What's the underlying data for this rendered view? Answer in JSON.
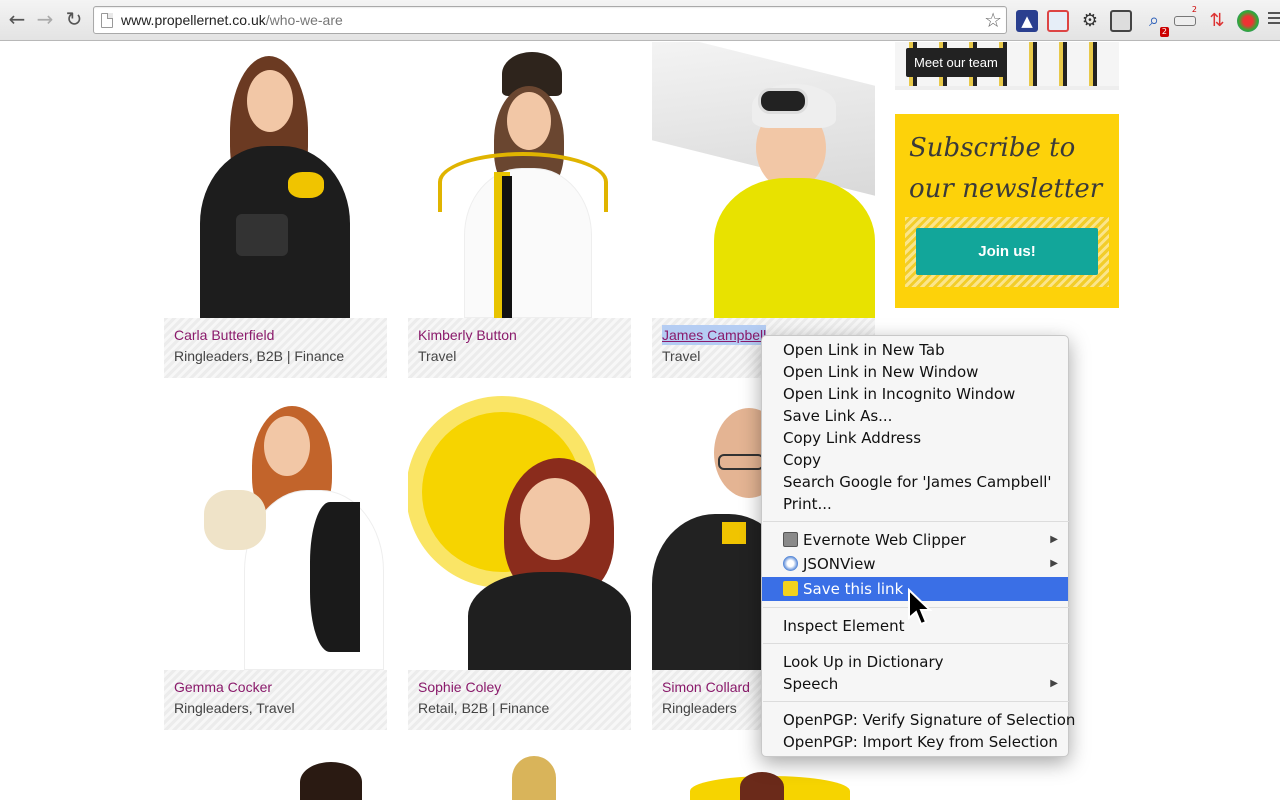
{
  "browser": {
    "url_host": "www.propellernet.co.uk",
    "url_path": "/who-we-are",
    "ext_badge": "2",
    "ext_badge2": "2"
  },
  "tooltip": {
    "text": "Meet our team"
  },
  "subscribe": {
    "title": "Subscribe to our newsletter",
    "button": "Join us!"
  },
  "people": [
    {
      "name": "Carla Butterfield",
      "dept": "Ringleaders, B2B | Finance"
    },
    {
      "name": "Kimberly Button",
      "dept": "Travel"
    },
    {
      "name": "James Campbell",
      "dept": "Travel"
    },
    {
      "name": "Gemma Cocker",
      "dept": "Ringleaders, Travel"
    },
    {
      "name": "Sophie Coley",
      "dept": "Retail, B2B | Finance"
    },
    {
      "name": "Simon Collard",
      "dept": "Ringleaders"
    }
  ],
  "context_menu": {
    "items": [
      "Open Link in New Tab",
      "Open Link in New Window",
      "Open Link in Incognito Window",
      "Save Link As...",
      "Copy Link Address",
      "Copy",
      "Search Google for 'James Campbell'",
      "Print..."
    ],
    "extensions": [
      {
        "label": "Evernote Web Clipper",
        "icon": "evernote-icon"
      },
      {
        "label": "JSONView",
        "icon": "jsonview-icon"
      },
      {
        "label": "Save this link",
        "icon": "save-link-icon"
      }
    ],
    "inspect": "Inspect Element",
    "lookup": "Look Up in Dictionary",
    "speech": "Speech",
    "openpgp_verify": "OpenPGP: Verify Signature of Selection",
    "openpgp_import": "OpenPGP: Import Key from Selection"
  }
}
